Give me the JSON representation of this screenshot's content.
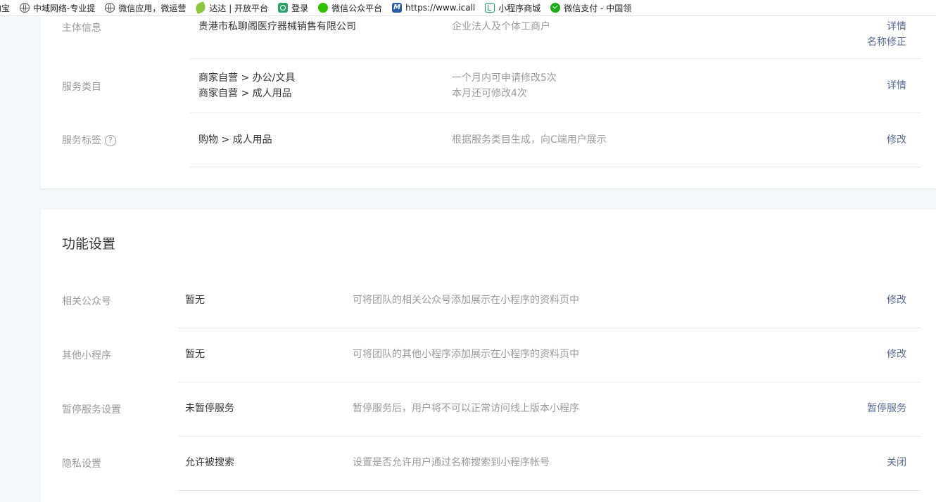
{
  "bookmarks": [
    {
      "label": "淘宝",
      "icon": "none"
    },
    {
      "label": "中域网络-专业提",
      "icon": "globe-icon"
    },
    {
      "label": "微信应用，微运营",
      "icon": "globe-icon"
    },
    {
      "label": "达达 | 开放平台",
      "icon": "leaf-icon"
    },
    {
      "label": "登录",
      "icon": "login-icon"
    },
    {
      "label": "微信公众平台",
      "icon": "wechat-icon"
    },
    {
      "label": "https://www.icall",
      "icon": "m-icon"
    },
    {
      "label": "小程序商城",
      "icon": "mini-icon"
    },
    {
      "label": "微信支付 - 中国领",
      "icon": "wechat-pay-icon"
    }
  ],
  "basic": {
    "subject": {
      "label": "主体信息",
      "value": "贵港市私聊阁医疗器械销售有限公司",
      "tip": "企业法人及个体工商户",
      "actions": [
        "详情",
        "名称修正"
      ]
    },
    "category": {
      "label": "服务类目",
      "values": [
        "商家自营 > 办公/文具",
        "商家自营 > 成人用品"
      ],
      "tips": [
        "一个月内可申请修改5次",
        "本月还可修改4次"
      ],
      "action": "详情"
    },
    "tags": {
      "label": "服务标签",
      "help": "?",
      "value": "购物 > 成人用品",
      "tip": "根据服务类目生成，向C端用户展示",
      "action": "修改"
    }
  },
  "features": {
    "title": "功能设置",
    "rows": [
      {
        "label": "相关公众号",
        "value": "暂无",
        "tip": "可将团队的相关公众号添加展示在小程序的资料页中",
        "action": "修改"
      },
      {
        "label": "其他小程序",
        "value": "暂无",
        "tip": "可将团队的其他小程序添加展示在小程序的资料页中",
        "action": "修改"
      },
      {
        "label": "暂停服务设置",
        "value": "未暂停服务",
        "tip": "暂停服务后，用户将不可以正常访问线上版本小程序",
        "action": "暂停服务"
      },
      {
        "label": "隐私设置",
        "value": "允许被搜索",
        "tip": "设置是否允许用户通过名称搜索到小程序帐号",
        "action": "关闭"
      }
    ]
  },
  "colors": {
    "link": "#576b95",
    "muted": "#9a9a9a",
    "text": "#353535",
    "background": "#f5f6f7"
  }
}
